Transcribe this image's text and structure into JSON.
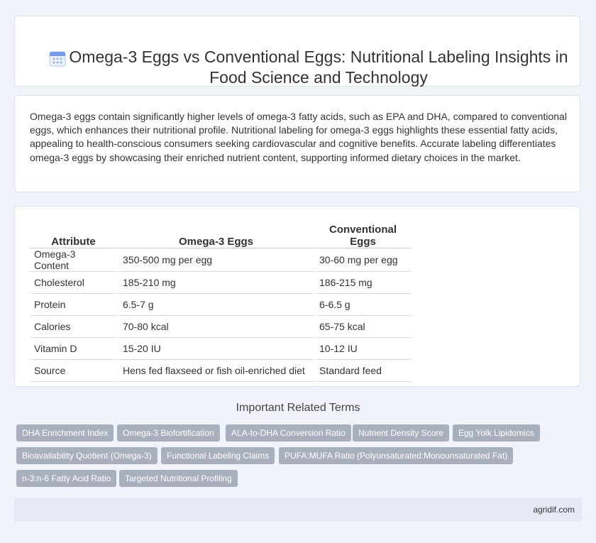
{
  "header": {
    "title": "Omega-3 Eggs vs Conventional Eggs: Nutritional Labeling Insights in Food Science and Technology",
    "icon": "calendar-icon"
  },
  "description": "Omega-3 eggs contain significantly higher levels of omega-3 fatty acids, such as EPA and DHA, compared to conventional eggs, which enhances their nutritional profile. Nutritional labeling for omega-3 eggs highlights these essential fatty acids, appealing to health-conscious consumers seeking cardiovascular and cognitive benefits. Accurate labeling differentiates omega-3 eggs by showcasing their enriched nutrient content, supporting informed dietary choices in the market.",
  "table": {
    "headers": [
      "Attribute",
      "Omega-3 Eggs",
      "Conventional Eggs"
    ],
    "rows": [
      [
        "Omega-3 Content",
        "350-500 mg per egg",
        "30-60 mg per egg"
      ],
      [
        "Cholesterol",
        "185-210 mg",
        "186-215 mg"
      ],
      [
        "Protein",
        "6.5-7 g",
        "6-6.5 g"
      ],
      [
        "Calories",
        "70-80 kcal",
        "65-75 kcal"
      ],
      [
        "Vitamin D",
        "15-20 IU",
        "10-12 IU"
      ],
      [
        "Source",
        "Hens fed flaxseed or fish oil-enriched diet",
        "Standard feed"
      ]
    ]
  },
  "related": {
    "title": "Important Related Terms",
    "tags": [
      "DHA Enrichment Index",
      "Omega-3 Biofortification",
      "ALA-to-DHA Conversion Ratio",
      "Nutrient Density Score",
      "Egg Yolk Lipidomics",
      "Bioavailability Quotient (Omega-3)",
      "Functional Labeling Claims",
      "PUFA:MUFA Ratio (Polyunsaturated:Monounsaturated Fat)",
      "n-3:n-6 Fatty Acid Ratio",
      "Targeted Nutritional Profiling"
    ]
  },
  "footer": {
    "site": "agridif.com"
  },
  "colors": {
    "background": "#f0f3f9",
    "tag": "#a9b0bd",
    "footer": "#e5eaf6",
    "icon_accent": "#5b8def"
  }
}
